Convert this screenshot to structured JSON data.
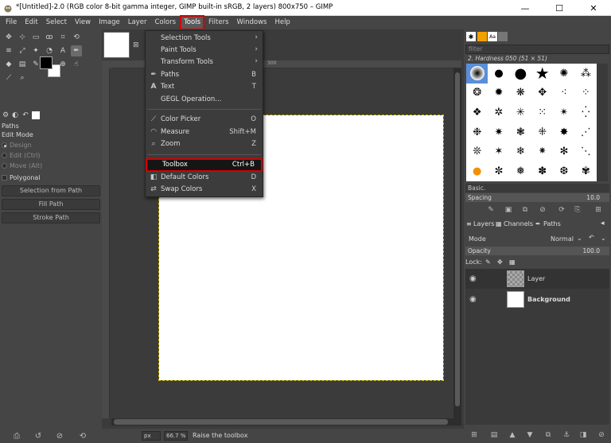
{
  "window": {
    "title": "*[Untitled]-2.0 (RGB color 8-bit gamma integer, GIMP built-in sRGB, 2 layers) 800x750 – GIMP",
    "minimize": "—",
    "maximize": "☐",
    "close": "✕"
  },
  "menubar": [
    "File",
    "Edit",
    "Select",
    "View",
    "Image",
    "Layer",
    "Colors",
    "Tools",
    "Filters",
    "Windows",
    "Help"
  ],
  "tools_menu": {
    "items": [
      {
        "label": "Selection Tools",
        "shortcut": "",
        "submenu": true
      },
      {
        "label": "Paint Tools",
        "shortcut": "",
        "submenu": true
      },
      {
        "label": "Transform Tools",
        "shortcut": "",
        "submenu": true
      },
      {
        "label": "Paths",
        "shortcut": "B",
        "submenu": false
      },
      {
        "label": "Text",
        "shortcut": "T",
        "submenu": false
      },
      {
        "label": "GEGL Operation...",
        "shortcut": "",
        "submenu": false
      },
      {
        "label": "Color Picker",
        "shortcut": "O",
        "submenu": false
      },
      {
        "label": "Measure",
        "shortcut": "Shift+M",
        "submenu": false
      },
      {
        "label": "Zoom",
        "shortcut": "Z",
        "submenu": false
      },
      {
        "label": "Toolbox",
        "shortcut": "Ctrl+B",
        "submenu": false
      },
      {
        "label": "Default Colors",
        "shortcut": "D",
        "submenu": false
      },
      {
        "label": "Swap Colors",
        "shortcut": "X",
        "submenu": false
      }
    ]
  },
  "tool_options": {
    "title": "Paths",
    "edit_mode_label": "Edit Mode",
    "modes": [
      "Design",
      "Edit (Ctrl)",
      "Move (Alt)"
    ],
    "polygonal": "Polygonal",
    "buttons": [
      "Selection from Path",
      "Fill Path",
      "Stroke Path"
    ]
  },
  "ruler": {
    "mark_300": "300"
  },
  "statusbar": {
    "unit": "px",
    "zoom": "66.7 %",
    "message": "Raise the toolbox"
  },
  "brushes": {
    "filter_placeholder": "filter",
    "current": "2. Hardness 050 (51 × 51)",
    "preset": "Basic.",
    "spacing_label": "Spacing",
    "spacing_value": "10.0"
  },
  "layers_panel": {
    "tabs": [
      "Layers",
      "Channels",
      "Paths"
    ],
    "mode_label": "Mode",
    "mode_value": "Normal",
    "opacity_label": "Opacity",
    "opacity_value": "100.0",
    "lock_label": "Lock:",
    "layers": [
      {
        "name": "Layer"
      },
      {
        "name": "Background"
      }
    ]
  },
  "colors": {
    "accent_highlight": "#d40000",
    "foreground": "#000000",
    "background": "#ffffff"
  }
}
